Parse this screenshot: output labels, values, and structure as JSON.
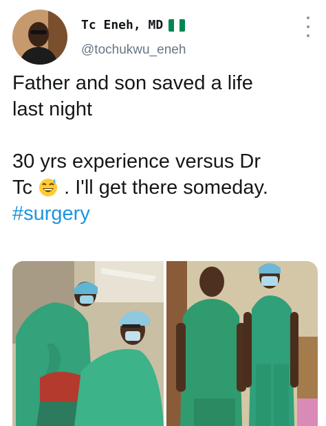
{
  "author": {
    "display_name": "Tc Eneh, MD",
    "handle": "@tochukwu_eneh",
    "flag_colors": [
      "#008751",
      "#ffffff",
      "#008751"
    ]
  },
  "tweet": {
    "line1": "Father and son saved a life",
    "line2": "last night",
    "line3": "30 yrs experience versus Dr",
    "line4_before": "Tc",
    "line4_after": ". I'll get there someday.",
    "hashtag": "#surgery",
    "emoji": "grinning-sweat-emoji"
  },
  "colors": {
    "link": "#1b95e0",
    "scrubs_green": "#3aa77f",
    "muted": "#657786"
  },
  "media": [
    "surgery-photo",
    "portrait-photo"
  ]
}
